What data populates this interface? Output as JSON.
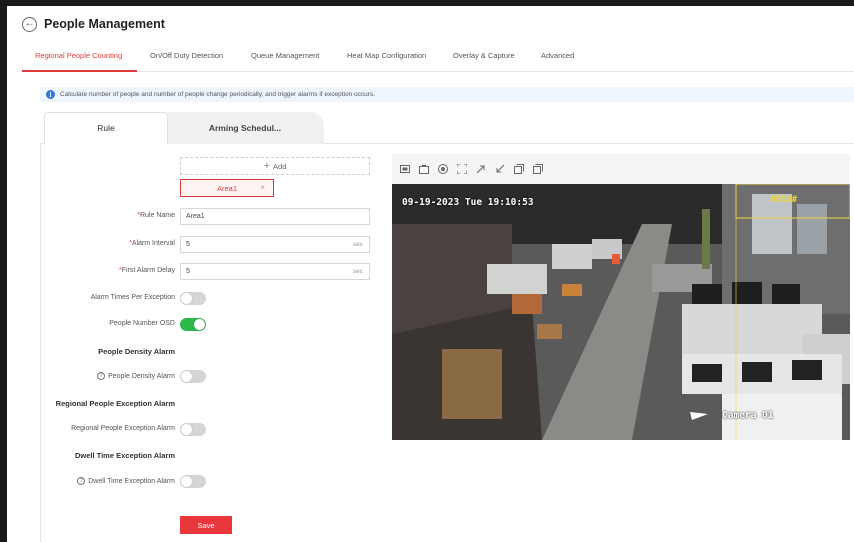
{
  "header": {
    "title": "People Management",
    "back_icon": "back-circle-icon"
  },
  "main_tabs": [
    {
      "label": "Regional People Counting",
      "active": true
    },
    {
      "label": "On/Off Duty Detection",
      "active": false
    },
    {
      "label": "Queue Management",
      "active": false
    },
    {
      "label": "Heat Map Configuration",
      "active": false
    },
    {
      "label": "Overlay & Capture",
      "active": false
    },
    {
      "label": "Advanced",
      "active": false
    }
  ],
  "info": {
    "icon": "info-icon",
    "text": "Calculate number of people and number of people change periodically, and trigger alarms if exception occurs."
  },
  "sub_tabs": [
    {
      "label": "Rule",
      "active": true
    },
    {
      "label": "Arming Schedul...",
      "active": false
    }
  ],
  "rule": {
    "add_label": "Add",
    "area_tag": "Area1",
    "rule_name_label": "Rule Name",
    "rule_name_value": "Area1",
    "alarm_interval_label": "Alarm Interval",
    "alarm_interval_value": "5",
    "alarm_interval_unit": "sec",
    "first_alarm_delay_label": "First Alarm Delay",
    "first_alarm_delay_value": "5",
    "first_alarm_delay_unit": "sec",
    "alarm_times_label": "Alarm Times Per Exception",
    "alarm_times_on": false,
    "people_osd_label": "People Number OSD",
    "people_osd_on": true,
    "density_section": "People Density Alarm",
    "density_alarm_label": "People Density Alarm",
    "density_alarm_on": false,
    "regional_section": "Regional People Exception Alarm",
    "regional_alarm_label": "Regional People Exception Alarm",
    "regional_alarm_on": false,
    "dwell_section": "Dwell Time Exception Alarm",
    "dwell_alarm_label": "Dwell Time Exception Alarm",
    "dwell_alarm_on": false,
    "save_label": "Save"
  },
  "video": {
    "toolbar_icons": [
      "draw-area-icon",
      "clear-icon",
      "record-icon",
      "fullscreen-icon",
      "zoom-in-icon",
      "zoom-out-icon",
      "copy-icon",
      "paste-icon"
    ],
    "timestamp": "09-19-2023 Tue 19:10:53",
    "osd_label": "#OSD#",
    "camera_name": "Camera 01"
  },
  "colors": {
    "accent": "#e03a3a",
    "toggle_on": "#2db84b",
    "info_blue": "#2d7ad8",
    "osd_yellow": "#f0d43a"
  }
}
